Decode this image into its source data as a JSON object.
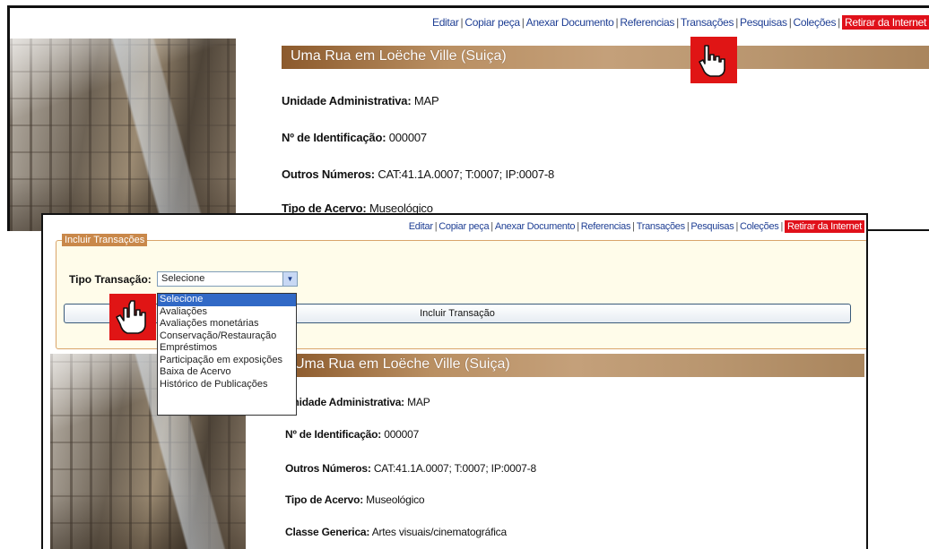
{
  "nav": {
    "items": [
      "Editar",
      "Copiar peça",
      "Anexar Documento",
      "Referencias",
      "Transações",
      "Pesquisas",
      "Coleções"
    ],
    "highlight": "Retirar da Internet"
  },
  "record": {
    "title": "Uma Rua em Loëche Ville (Suiça)",
    "fields": [
      {
        "label": "Unidade Administrativa:",
        "value": "MAP"
      },
      {
        "label": "Nº de Identificação:",
        "value": "000007"
      },
      {
        "label": "Outros Números:",
        "value": "CAT:41.1A.0007; T:0007; IP:0007-8"
      },
      {
        "label": "Tipo de Acervo:",
        "value": "Museológico"
      },
      {
        "label": "Classe Generica:",
        "value": "Artes visuais/cinematográfica"
      }
    ]
  },
  "transaction": {
    "legend": "Incluir Transações",
    "type_label": "Tipo Transação:",
    "selected": "Selecione",
    "button": "Incluir Transação",
    "options": [
      "Selecione",
      "Avaliações",
      "Avaliações monetárias",
      "Conservação/Restauração",
      "Empréstimos",
      "Participação em exposições",
      "Baixa de Acervo",
      "Histórico de Publicações"
    ]
  },
  "colors": {
    "nav_link": "#1f3f94",
    "highlight": "#e0101a",
    "title_bar": "#b08357",
    "legend": "#c9884a",
    "dropdown_selected": "#3169c6",
    "cursor_bg": "#e01515"
  },
  "icons": {
    "pointer": "hand-pointer-icon",
    "select_arrow": "chevron-down-icon"
  }
}
